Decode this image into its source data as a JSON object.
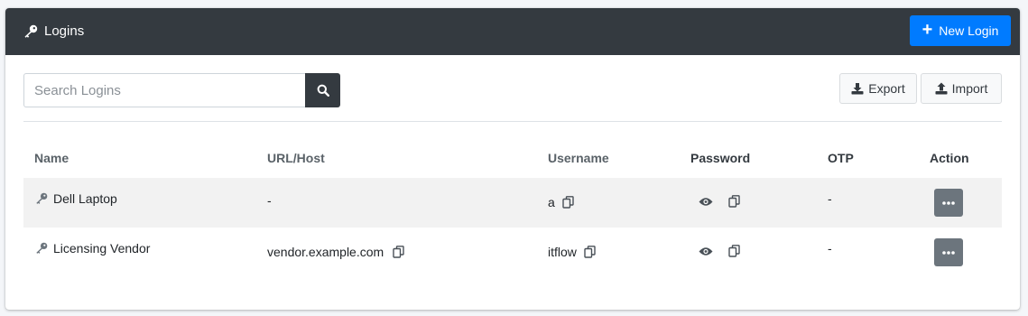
{
  "header": {
    "title": "Logins",
    "title_icon": "key-icon",
    "new_button_label": "New Login",
    "new_button_icon": "plus-icon",
    "accent_color": "#007bff",
    "header_color": "#343a40"
  },
  "toolbar": {
    "search_placeholder": "Search Logins",
    "search_value": "",
    "search_button_icon": "search-icon",
    "export_label": "Export",
    "export_icon": "download-icon",
    "import_label": "Import",
    "import_icon": "upload-icon"
  },
  "table": {
    "columns": [
      "Name",
      "URL/Host",
      "Username",
      "Password",
      "OTP",
      "Action"
    ],
    "rows": [
      {
        "name": "Dell Laptop",
        "url": "-",
        "username": "a",
        "otp": "-",
        "has_url_copy": false
      },
      {
        "name": "Licensing Vendor",
        "url": "vendor.example.com",
        "username": "itflow",
        "otp": "-",
        "has_url_copy": true
      }
    ]
  }
}
